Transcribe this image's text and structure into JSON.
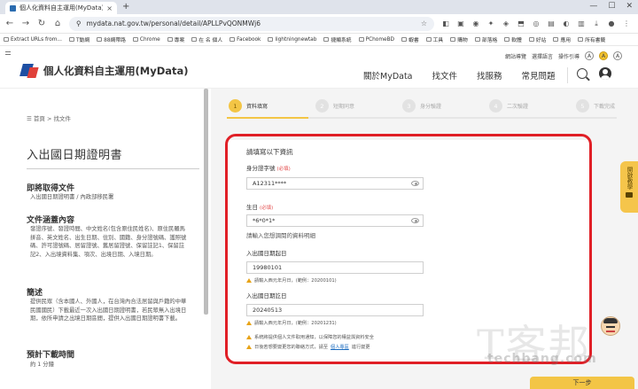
{
  "browser": {
    "tab_title": "個人化資料自主運用(MyData)",
    "tab_close": "×",
    "new_tab": "+",
    "window_controls": [
      "—",
      "☐",
      "✕"
    ],
    "url": "mydata.nat.gov.tw/personal/detail/APLLPvQONMWj6",
    "bookmarks": [
      "Extract URLs from...",
      "T動網",
      "88網帶路",
      "Chrome",
      "專案",
      "在 名 個人",
      "Facebook",
      "lightningnewtab",
      "捷顯系統",
      "PChomeBD",
      "蝦書",
      "工具",
      "購物",
      "部落格",
      "軟體",
      "好站",
      "應用",
      "所有書籤"
    ]
  },
  "header": {
    "site_name": "個人化資料自主運用(MyData)",
    "util_links": [
      "網站導覽",
      "選擇語言",
      "操作引導"
    ],
    "font_sizes": [
      "A",
      "A",
      "A"
    ],
    "nav": [
      "關於MyData",
      "找文件",
      "找服務",
      "常見問題"
    ]
  },
  "sidebar": {
    "breadcrumb_home": "首頁",
    "breadcrumb_sep": ">",
    "breadcrumb_current": "找文件",
    "doc_title": "入出國日期證明書",
    "sections": [
      {
        "heading": "即將取得文件",
        "body": "入出國日期證明書 / 內政部移民署"
      },
      {
        "heading": "文件涵蓋內容",
        "body": "發證序號、發證時間、中文姓名(包含原住民姓名)、原住民羅馬拼音、英文姓名、出生日期、住別、國籍、身分證號碼、護照號碼、許可證號碼、居留證號、舊居留證號、保留註記1、保留註記2、入出境資料集、項次、出境日期、入境日期。"
      },
      {
        "heading": "簡述",
        "body": "提供民眾（含本國人、外國人，在台灣內合法居留與戶籍的中華民國國民）下載最近一次入出國日期證明書，若民眾無入出境日期，依所申請之出境日期區間，提供入出國日期證明書下載。"
      },
      {
        "heading": "預計下載時間",
        "body": "約 1 分鐘"
      }
    ]
  },
  "steps": [
    {
      "num": "1",
      "label": "資料填寫"
    },
    {
      "num": "2",
      "label": "短期同意"
    },
    {
      "num": "3",
      "label": "身分驗證"
    },
    {
      "num": "4",
      "label": "二次驗證"
    },
    {
      "num": "5",
      "label": "下載完成"
    }
  ],
  "form": {
    "title": "請填寫以下資訊",
    "id_label": "身分證字號",
    "id_req": "(必填)",
    "id_value": "A12311****",
    "birth_label": "生日",
    "birth_req": "(必填)",
    "birth_value": "*6*0*1*",
    "birth_hint": "請輸入您想調閱的資料明細",
    "start_label": "入出國日期起日",
    "start_value": "19980101",
    "start_note": "請輸入西元年月日，(範例：20200101)",
    "end_label": "入出國日期訖日",
    "end_value": "20240513",
    "end_note": "請輸入西元年月日，(範例：20201231)",
    "note_system": "系統將提供個人文件取用通知，以保障您的權益與資料安全",
    "note_contact_pre": "日後若想要變更您的聯絡方式，請至",
    "note_contact_link": "個人專區",
    "note_contact_post": "進行變更"
  },
  "side_tab": {
    "label": "開啟教學"
  },
  "next_button": "下一步",
  "watermark": {
    "main": "T客邦",
    "sub": "techbang.com"
  },
  "colors": {
    "accent": "#f3c545",
    "highlight": "#e01f26",
    "brand_blue": "#1e4fa3",
    "brand_red": "#e0413a"
  }
}
